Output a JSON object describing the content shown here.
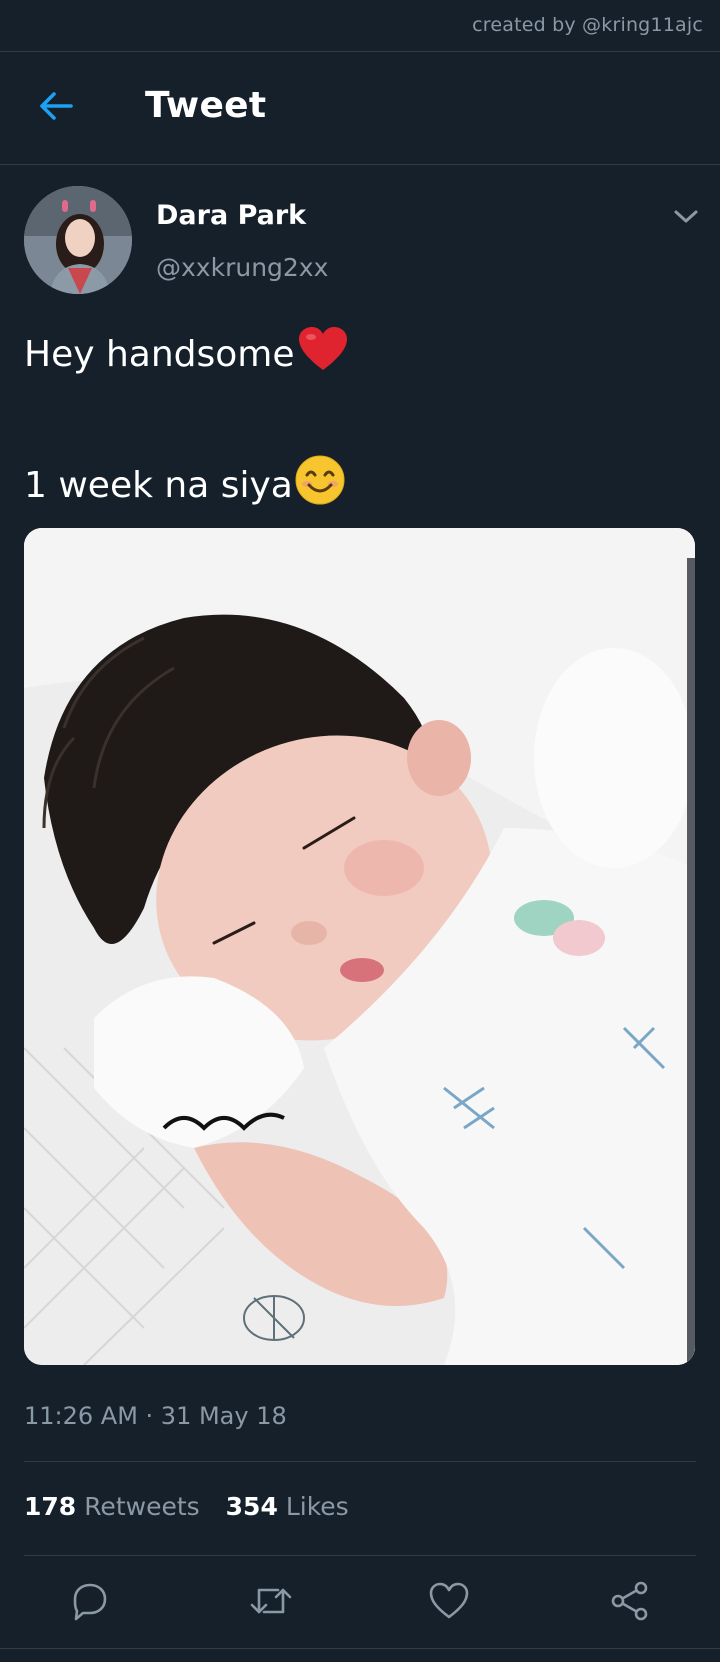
{
  "watermark": "created by @kring11ajc",
  "header": {
    "title": "Tweet",
    "back_icon": "arrow-left-icon"
  },
  "tweet": {
    "author_name": "Dara Park",
    "author_handle": "@xxkrung2xx",
    "text_line1": "Hey handsome",
    "text_line2": "1 week na siya",
    "emoji_line1": "red-heart",
    "emoji_line2": "smiling-face",
    "media_alt": "sleeping newborn baby photo",
    "timestamp": "11:26 AM · 31 May 18",
    "retweets_count": "178",
    "retweets_label": "Retweets",
    "likes_count": "354",
    "likes_label": "Likes"
  },
  "actions": [
    {
      "icon": "reply-icon"
    },
    {
      "icon": "retweet-icon"
    },
    {
      "icon": "like-icon"
    },
    {
      "icon": "share-icon"
    }
  ],
  "colors": {
    "background": "#15202b",
    "accent": "#1da1f2",
    "secondary_text": "#8b98a5",
    "divider": "#2f3b47"
  }
}
